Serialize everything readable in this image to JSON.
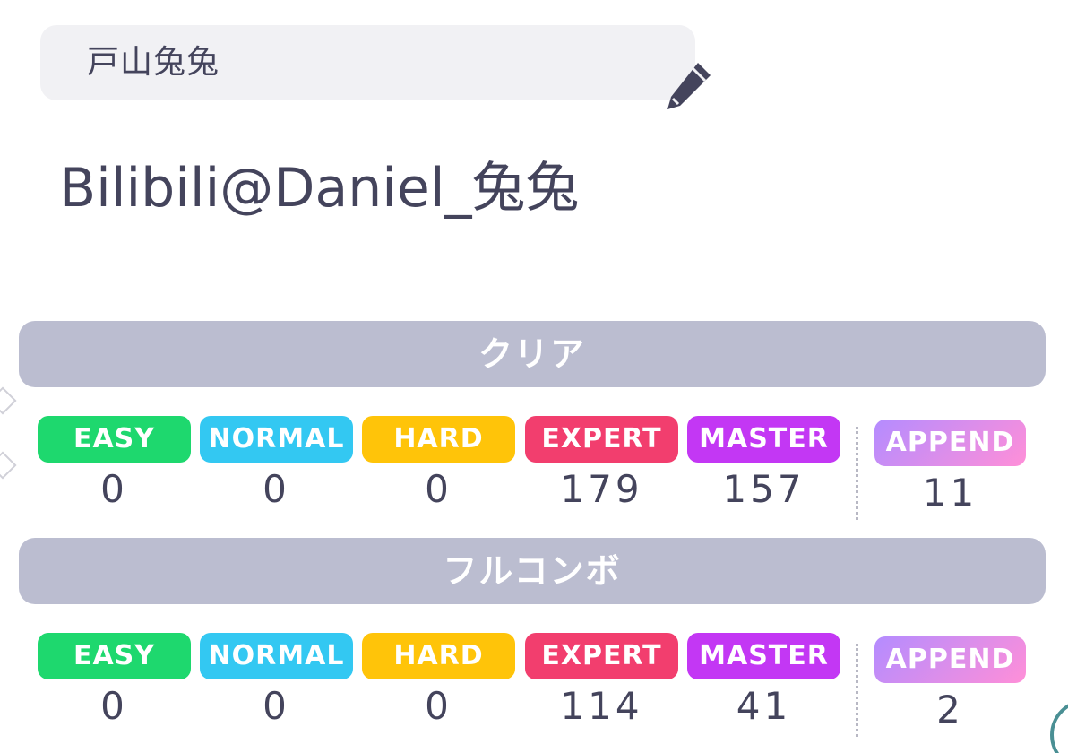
{
  "profile": {
    "name": "戸山兔兔",
    "handle": "Bilibili@Daniel_兔兔",
    "edit_icon": "pencil-icon"
  },
  "sections": {
    "clear": {
      "title": "クリア",
      "stats": [
        {
          "difficulty": "EASY",
          "count": "0",
          "color": "#1ed86e"
        },
        {
          "difficulty": "NORMAL",
          "count": "0",
          "color": "#33c8f2"
        },
        {
          "difficulty": "HARD",
          "count": "0",
          "color": "#ffc409"
        },
        {
          "difficulty": "EXPERT",
          "count": "179",
          "color": "#f23e6e"
        },
        {
          "difficulty": "MASTER",
          "count": "157",
          "color": "#c337f4"
        },
        {
          "difficulty": "APPEND",
          "count": "11",
          "color": "gradient #b48cff→#ff8fd8"
        }
      ]
    },
    "full_combo": {
      "title": "フルコンボ",
      "stats": [
        {
          "difficulty": "EASY",
          "count": "0",
          "color": "#1ed86e"
        },
        {
          "difficulty": "NORMAL",
          "count": "0",
          "color": "#33c8f2"
        },
        {
          "difficulty": "HARD",
          "count": "0",
          "color": "#ffc409"
        },
        {
          "difficulty": "EXPERT",
          "count": "114",
          "color": "#f23e6e"
        },
        {
          "difficulty": "MASTER",
          "count": "41",
          "color": "#c337f4"
        },
        {
          "difficulty": "APPEND",
          "count": "2",
          "color": "gradient #b48cff→#ff8fd8"
        }
      ]
    }
  },
  "colors": {
    "text": "#44445c",
    "field_bg": "#f1f1f4",
    "section_bar": "#bbbdd0"
  }
}
